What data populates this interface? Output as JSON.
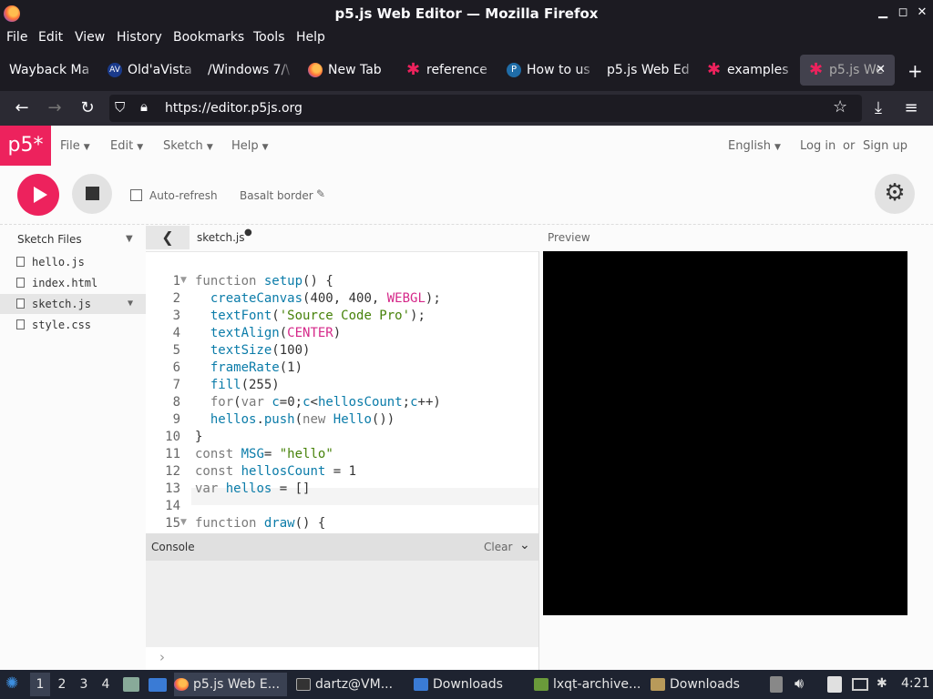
{
  "window": {
    "title": "p5.js Web Editor — Mozilla Firefox",
    "minimize": "▁",
    "maximize": "◻",
    "close": "✕"
  },
  "menubar": [
    "File",
    "Edit",
    "View",
    "History",
    "Bookmarks",
    "Tools",
    "Help"
  ],
  "tabs": [
    {
      "label": "Wayback Ma",
      "icon": "none"
    },
    {
      "label": "Old'aVista",
      "icon": "av-icon"
    },
    {
      "label": "/Windows 7/\\",
      "icon": "none"
    },
    {
      "label": "New Tab",
      "icon": "firefox-icon"
    },
    {
      "label": "reference",
      "icon": "p5-star-icon"
    },
    {
      "label": "How to us",
      "icon": "p-icon"
    },
    {
      "label": "p5.js Web Ed",
      "icon": "none"
    },
    {
      "label": "examples",
      "icon": "p5-star-icon"
    },
    {
      "label": "p5.js We",
      "icon": "p5-star-icon",
      "active": true
    }
  ],
  "newtab": "+",
  "nav": {
    "url": "https://editor.p5js.org"
  },
  "p5": {
    "logo": "p5*",
    "menus": [
      "File",
      "Edit",
      "Sketch",
      "Help"
    ],
    "language": "English",
    "login": "Log in",
    "or": "or",
    "signup": "Sign up",
    "autorefresh": "Auto-refresh",
    "sketch_name": "Basalt border",
    "sketch_files": "Sketch Files",
    "files": [
      "hello.js",
      "index.html",
      "sketch.js",
      "style.css"
    ],
    "selected_file": "sketch.js",
    "tab_name": "sketch.js",
    "preview_label": "Preview",
    "console_label": "Console",
    "clear_label": "Clear",
    "prompt": "›"
  },
  "code": {
    "line_numbers": [
      "1",
      "2",
      "3",
      "4",
      "5",
      "6",
      "7",
      "8",
      "9",
      "10",
      "11",
      "12",
      "13",
      "14",
      "15"
    ],
    "lines": [
      "function setup() {",
      "  createCanvas(400, 400, WEBGL);",
      "  textFont('Source Code Pro');",
      "  textAlign(CENTER)",
      "  textSize(100)",
      "  frameRate(1)",
      "  fill(255)",
      "  for(var c=0;c<hellosCount;c++)",
      "  hellos.push(new Hello())",
      "}",
      "const MSG= \"hello\"",
      "const hellosCount = 1",
      "var hellos = []",
      "",
      "function draw() {"
    ]
  },
  "taskbar": {
    "workspaces": [
      "1",
      "2",
      "3",
      "4"
    ],
    "items": [
      "p5.js Web E...",
      "dartz@VM...",
      "Downloads",
      "lxqt-archive...",
      "Downloads"
    ],
    "clock": "4:21"
  },
  "colors": {
    "p5_pink": "#ed225d",
    "firefox_dark": "#1c1b22"
  }
}
